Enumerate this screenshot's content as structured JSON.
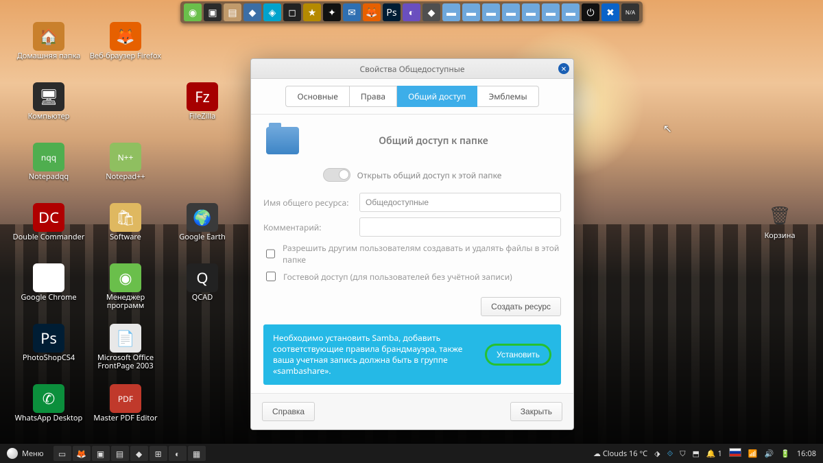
{
  "topdock": [
    {
      "name": "mint-menu",
      "bg": "#6abf4b",
      "glyph": "◉"
    },
    {
      "name": "terminal",
      "bg": "#2b2b2b",
      "glyph": "▣"
    },
    {
      "name": "files",
      "bg": "#c19a6b",
      "glyph": "▤"
    },
    {
      "name": "app1",
      "bg": "#3b6ea5",
      "glyph": "◆"
    },
    {
      "name": "app2",
      "bg": "#00a3cc",
      "glyph": "◈"
    },
    {
      "name": "app3",
      "bg": "#222",
      "glyph": "◻"
    },
    {
      "name": "app4",
      "bg": "#b58a00",
      "glyph": "★"
    },
    {
      "name": "app5",
      "bg": "#111",
      "glyph": "✦"
    },
    {
      "name": "thunderbird",
      "bg": "#2f6fb2",
      "glyph": "✉"
    },
    {
      "name": "firefox",
      "bg": "#e66000",
      "glyph": "🦊"
    },
    {
      "name": "photoshop",
      "bg": "#001d34",
      "glyph": "Ps"
    },
    {
      "name": "app6",
      "bg": "#6a4fbf",
      "glyph": "◐"
    },
    {
      "name": "app7",
      "bg": "#4f4f4f",
      "glyph": "◆"
    },
    {
      "name": "folder1",
      "bg": "#6fa8dc",
      "glyph": "▬"
    },
    {
      "name": "folder2",
      "bg": "#6fa8dc",
      "glyph": "▬"
    },
    {
      "name": "folder3",
      "bg": "#6fa8dc",
      "glyph": "▬"
    },
    {
      "name": "folder4",
      "bg": "#6fa8dc",
      "glyph": "▬"
    },
    {
      "name": "folder5",
      "bg": "#6fa8dc",
      "glyph": "▬"
    },
    {
      "name": "folder6",
      "bg": "#6fa8dc",
      "glyph": "▬"
    },
    {
      "name": "folder7",
      "bg": "#6fa8dc",
      "glyph": "▬"
    },
    {
      "name": "shutdown",
      "bg": "#111",
      "glyph": "⏻"
    },
    {
      "name": "accessibility",
      "bg": "#0a63c9",
      "glyph": "✖"
    },
    {
      "name": "na",
      "bg": "#333",
      "glyph": "N/A"
    }
  ],
  "desktop_icons": [
    {
      "name": "home-folder",
      "label": "Домашняя папка",
      "bg": "#c9802c",
      "glyph": "🏠"
    },
    {
      "name": "firefox",
      "label": "Веб-браузер Firefox",
      "bg": "#e66000",
      "glyph": "🦊"
    },
    {
      "name": "spacer1",
      "label": "",
      "bg": "transparent",
      "glyph": ""
    },
    {
      "name": "computer",
      "label": "Компьютер",
      "bg": "#2b2b2b",
      "glyph": "🖥"
    },
    {
      "name": "spacer2",
      "label": "",
      "bg": "transparent",
      "glyph": ""
    },
    {
      "name": "filezilla",
      "label": "FileZilla",
      "bg": "#a60000",
      "glyph": "Fz"
    },
    {
      "name": "notepadqq",
      "label": "Notepadqq",
      "bg": "#4fae4f",
      "glyph": "nqq"
    },
    {
      "name": "notepadpp",
      "label": "Notepad++",
      "bg": "#8fbf60",
      "glyph": "N++"
    },
    {
      "name": "spacer3",
      "label": "",
      "bg": "transparent",
      "glyph": ""
    },
    {
      "name": "double-commander",
      "label": "Double Commander",
      "bg": "#b00000",
      "glyph": "DC"
    },
    {
      "name": "software",
      "label": "Software",
      "bg": "#dfb860",
      "glyph": "🛍"
    },
    {
      "name": "google-earth",
      "label": "Google Earth",
      "bg": "#3a3a3a",
      "glyph": "🌍"
    },
    {
      "name": "google-chrome",
      "label": "Google Chrome",
      "bg": "#fff",
      "glyph": "⬤"
    },
    {
      "name": "program-manager",
      "label": "Менеджер программ",
      "bg": "#6abf4b",
      "glyph": "◉"
    },
    {
      "name": "qcad",
      "label": "QCAD",
      "bg": "#222",
      "glyph": "Q"
    },
    {
      "name": "photoshop",
      "label": "PhotoShopCS4",
      "bg": "#001d34",
      "glyph": "Ps"
    },
    {
      "name": "frontpage",
      "label": "Microsoft Office FrontPage 2003",
      "bg": "#e8e8e8",
      "glyph": "📄"
    },
    {
      "name": "spacer4",
      "label": "",
      "bg": "transparent",
      "glyph": ""
    },
    {
      "name": "whatsapp",
      "label": "WhatsApp Desktop",
      "bg": "#0b8f3c",
      "glyph": "✆"
    },
    {
      "name": "master-pdf",
      "label": "Master PDF Editor",
      "bg": "#c0392b",
      "glyph": "PDF"
    }
  ],
  "trash": {
    "label": "Корзина"
  },
  "dialog": {
    "title": "Свойства Общедоступные",
    "tabs": [
      "Основные",
      "Права",
      "Общий доступ",
      "Эмблемы"
    ],
    "active_tab": 2,
    "heading": "Общий доступ к папке",
    "toggle_label": "Открыть общий доступ к этой папке",
    "share_name_label": "Имя общего ресурса:",
    "share_name_value": "Общедоступные",
    "comment_label": "Комментарий:",
    "comment_value": "",
    "perm_check": "Разрешить другим пользователям создавать и удалять файлы в этой папке",
    "guest_check": "Гостевой доступ (для пользователей без учётной записи)",
    "create_btn": "Создать ресурс",
    "info_msg": "Необходимо установить Samba, добавить соответствующие правила брандмауэра, также ваша учетная запись должна быть в группе «sambashare».",
    "install_btn": "Установить",
    "help_btn": "Справка",
    "close_btn": "Закрыть"
  },
  "panel": {
    "menu": "Меню",
    "tasks": [
      {
        "name": "show-desktop",
        "glyph": "▭"
      },
      {
        "name": "firefox",
        "glyph": "🦊"
      },
      {
        "name": "terminal",
        "glyph": "▣"
      },
      {
        "name": "files",
        "glyph": "▤"
      },
      {
        "name": "app",
        "glyph": "◆"
      },
      {
        "name": "wine",
        "glyph": "⊞"
      },
      {
        "name": "app2",
        "glyph": "◐"
      },
      {
        "name": "app3",
        "glyph": "▦"
      }
    ],
    "weather": "Clouds 16 °C",
    "clock": "16:08",
    "vol_badge": "1"
  }
}
